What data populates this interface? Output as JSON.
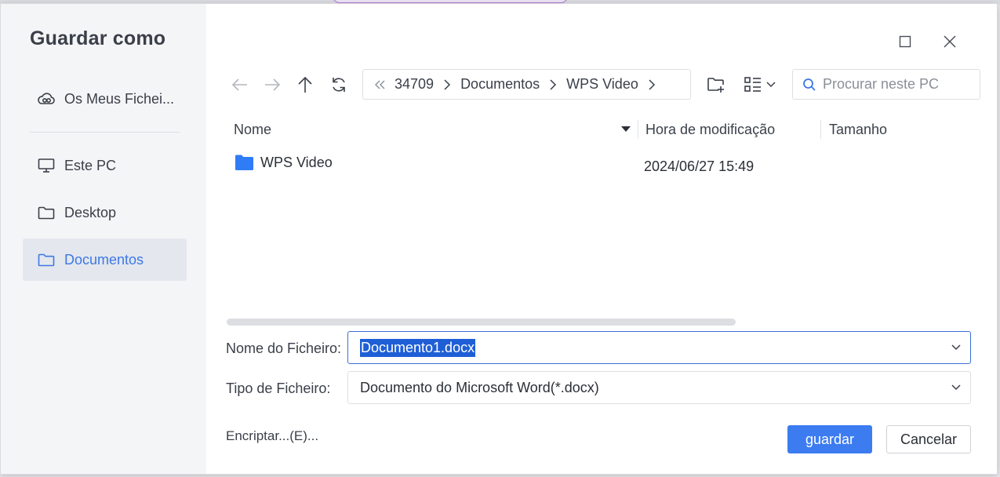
{
  "dialog": {
    "title": "Guardar como"
  },
  "sidebar": {
    "items": [
      {
        "label": "Os Meus Fichei...",
        "icon": "cloud-icon"
      },
      {
        "label": "Este PC",
        "icon": "monitor-icon"
      },
      {
        "label": "Desktop",
        "icon": "folder-icon"
      },
      {
        "label": "Documentos",
        "icon": "folder-icon",
        "active": true
      }
    ]
  },
  "breadcrumb": {
    "items": [
      "34709",
      "Documentos",
      "WPS Video"
    ]
  },
  "search": {
    "placeholder": "Procurar neste PC"
  },
  "columns": {
    "name": "Nome",
    "modified": "Hora de modificação",
    "size": "Tamanho"
  },
  "files": [
    {
      "name": "WPS Video",
      "modified": "2024/06/27 15:49",
      "size": "",
      "icon": "folder-icon"
    }
  ],
  "form": {
    "filename_label": "Nome do Ficheiro:",
    "filename_value": "Documento1.docx",
    "filetype_label": "Tipo de Ficheiro:",
    "filetype_value": "Documento do Microsoft Word(*.docx)"
  },
  "footer": {
    "encrypt_label": "Encriptar...(E)...",
    "save_label": "guardar",
    "cancel_label": "Cancelar"
  },
  "colors": {
    "accent": "#3c7cf0",
    "active_text": "#3d78e4",
    "folder": "#2f7cf6"
  }
}
